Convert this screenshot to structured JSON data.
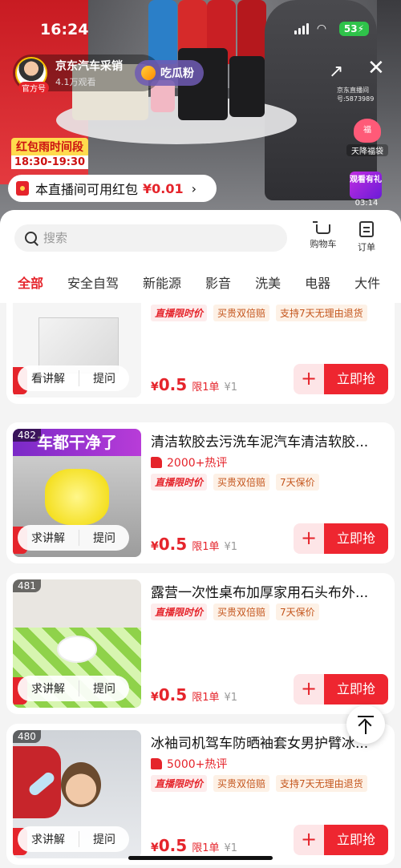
{
  "status_bar": {
    "time": "16:24",
    "battery": "53"
  },
  "live": {
    "anchor_name": "京东汽车采销",
    "anchor_badge": "官方号",
    "viewers": "4.1万观看",
    "fan_button": "吃瓜粉",
    "live_id": "京东直播间号:5873989",
    "sale_title": "红包雨时间段",
    "sale_time": "18:30-19:30",
    "fortune_bag_label": "天降福袋",
    "fortune_bag_char": "福",
    "watch_gift_label": "观看有礼",
    "watch_gift_time": "03:14",
    "redpacket_text": "本直播间可用红包",
    "redpacket_amount": "¥0.01"
  },
  "panel": {
    "search_placeholder": "搜索",
    "cart_label": "购物车",
    "order_label": "订单",
    "tabs": [
      "全部",
      "安全自驾",
      "新能源",
      "影音",
      "洗美",
      "电器",
      "大件"
    ],
    "active_tab": 0
  },
  "products": [
    {
      "rank": "",
      "title": "",
      "hot": "",
      "tags": [
        "直播限时价",
        "买贵双倍赔",
        "支持7天无理由退货"
      ],
      "price_symbol": "¥",
      "price": "0.5",
      "limit": "限1单",
      "orig": "¥1",
      "action_left": "看讲解",
      "action_right": "提问",
      "buy": "立即抢"
    },
    {
      "rank": "482",
      "title": "清洁软胶去污洗车泥汽车清洁软胶...",
      "thumb_text": "车都干净了",
      "hot": "2000+热评",
      "tags": [
        "直播限时价",
        "买贵双倍赔",
        "7天保价"
      ],
      "price_symbol": "¥",
      "price": "0.5",
      "limit": "限1单",
      "orig": "¥1",
      "action_left": "求讲解",
      "action_right": "提问",
      "buy": "立即抢"
    },
    {
      "rank": "481",
      "title": "露营一次性桌布加厚家用石头布外...",
      "hot": "",
      "tags": [
        "直播限时价",
        "买贵双倍赔",
        "7天保价"
      ],
      "price_symbol": "¥",
      "price": "0.5",
      "limit": "限1单",
      "orig": "¥1",
      "action_left": "求讲解",
      "action_right": "提问",
      "buy": "立即抢"
    },
    {
      "rank": "480",
      "title": "冰袖司机驾车防晒袖套女男护臂冰...",
      "hot": "5000+热评",
      "tags": [
        "直播限时价",
        "买贵双倍赔",
        "支持7天无理由退货"
      ],
      "price_symbol": "¥",
      "price": "0.5",
      "limit": "限1单",
      "orig": "¥1",
      "action_left": "求讲解",
      "action_right": "提问",
      "buy": "立即抢"
    }
  ],
  "colors": {
    "accent": "#e5242b",
    "buy": "#ee2630",
    "tag_bg": "#fdecec"
  }
}
